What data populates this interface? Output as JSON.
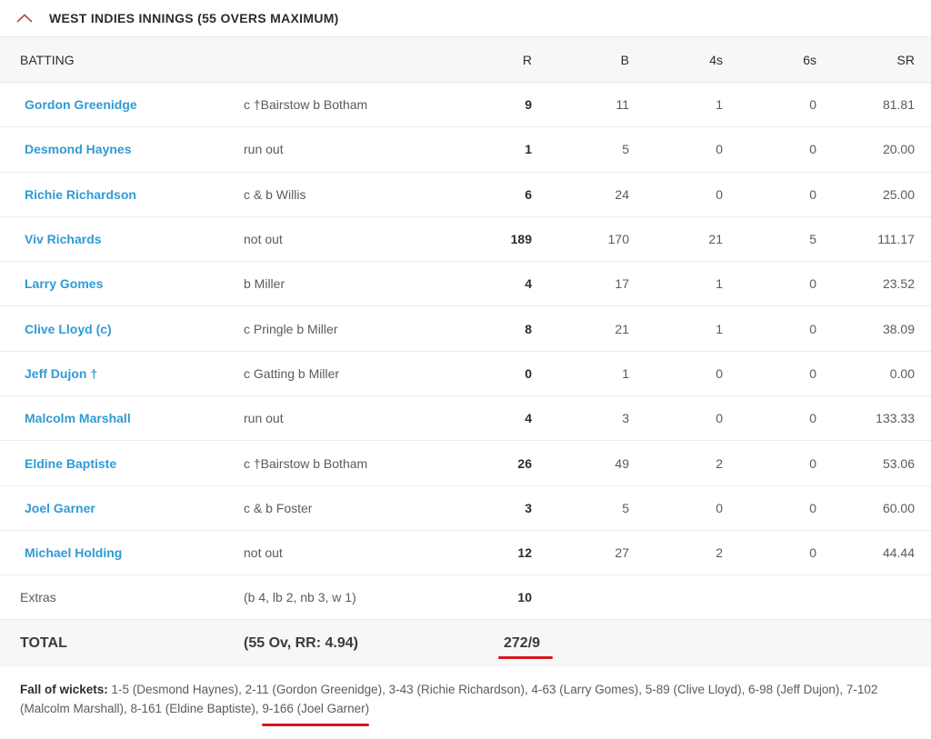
{
  "innings": {
    "title": "WEST INDIES INNINGS (55 OVERS MAXIMUM)",
    "toggle_icon": "chevron-up-icon",
    "accent_color": "#d8141b",
    "link_color": "#2f9bd4"
  },
  "headers": {
    "batting": "BATTING",
    "dismissal": "",
    "r": "R",
    "b": "B",
    "fours": "4s",
    "sixes": "6s",
    "sr": "SR"
  },
  "batsmen": [
    {
      "name": "Gordon Greenidge",
      "dismissal": "c †Bairstow b Botham",
      "r": "9",
      "b": "11",
      "fours": "1",
      "sixes": "0",
      "sr": "81.81"
    },
    {
      "name": "Desmond Haynes",
      "dismissal": "run out",
      "r": "1",
      "b": "5",
      "fours": "0",
      "sixes": "0",
      "sr": "20.00"
    },
    {
      "name": "Richie Richardson",
      "dismissal": "c & b Willis",
      "r": "6",
      "b": "24",
      "fours": "0",
      "sixes": "0",
      "sr": "25.00"
    },
    {
      "name": "Viv Richards",
      "dismissal": "not out",
      "r": "189",
      "b": "170",
      "fours": "21",
      "sixes": "5",
      "sr": "111.17"
    },
    {
      "name": "Larry Gomes",
      "dismissal": "b Miller",
      "r": "4",
      "b": "17",
      "fours": "1",
      "sixes": "0",
      "sr": "23.52"
    },
    {
      "name": "Clive Lloyd (c)",
      "dismissal": "c Pringle b Miller",
      "r": "8",
      "b": "21",
      "fours": "1",
      "sixes": "0",
      "sr": "38.09"
    },
    {
      "name": "Jeff Dujon †",
      "dismissal": "c Gatting b Miller",
      "r": "0",
      "b": "1",
      "fours": "0",
      "sixes": "0",
      "sr": "0.00"
    },
    {
      "name": "Malcolm Marshall",
      "dismissal": "run out",
      "r": "4",
      "b": "3",
      "fours": "0",
      "sixes": "0",
      "sr": "133.33"
    },
    {
      "name": "Eldine Baptiste",
      "dismissal": "c †Bairstow b Botham",
      "r": "26",
      "b": "49",
      "fours": "2",
      "sixes": "0",
      "sr": "53.06"
    },
    {
      "name": "Joel Garner",
      "dismissal": "c & b Foster",
      "r": "3",
      "b": "5",
      "fours": "0",
      "sixes": "0",
      "sr": "60.00"
    },
    {
      "name": "Michael Holding",
      "dismissal": "not out",
      "r": "12",
      "b": "27",
      "fours": "2",
      "sixes": "0",
      "sr": "44.44"
    }
  ],
  "extras": {
    "label": "Extras",
    "detail": "(b 4, lb 2, nb 3, w 1)",
    "runs": "10"
  },
  "total": {
    "label": "TOTAL",
    "detail": "(55 Ov, RR: 4.94)",
    "score": "272/9"
  },
  "fall_of_wickets": {
    "label": "Fall of wickets:",
    "text": " 1-5 (Desmond Haynes), 2-11 (Gordon Greenidge), 3-43 (Richie Richardson), 4-63 (Larry Gomes), 5-89 (Clive Lloyd), 6-98 (Jeff Dujon), 7-102 (Malcolm Marshall), 8-161 (Eldine Baptiste), ",
    "highlighted": "9-166 (Joel Garner)"
  }
}
